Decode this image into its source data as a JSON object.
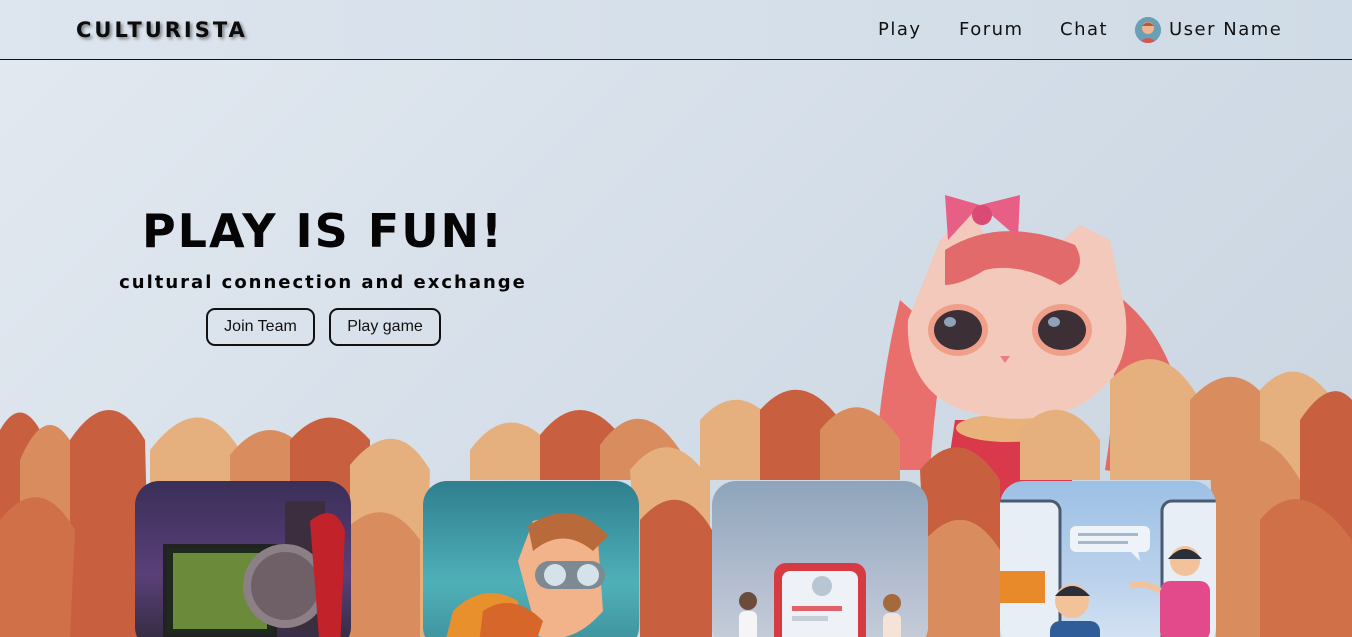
{
  "nav": {
    "logo": "CULTURISTA",
    "links": [
      "Play",
      "Forum",
      "Chat"
    ],
    "user_name": "User Name"
  },
  "hero": {
    "title": "PLAY IS FUN!",
    "subtitle": "cultural connection and exchange",
    "buttons": [
      "Join Team",
      "Play game"
    ]
  },
  "colors": {
    "leaf_dark": "#c8603f",
    "leaf_mid": "#d98c5e",
    "leaf_light": "#e6b07e",
    "cat_fur": "#f3c9bb",
    "cat_hair": "#e86f6c"
  },
  "cards": [
    {
      "name": "game-card-space-astronaut",
      "icon": "astronaut-image"
    },
    {
      "name": "game-card-aviator-boy",
      "icon": "aviator-boy-image"
    },
    {
      "name": "game-card-team-app",
      "icon": "team-app-image"
    },
    {
      "name": "game-card-video-chat",
      "icon": "video-chat-image"
    }
  ]
}
